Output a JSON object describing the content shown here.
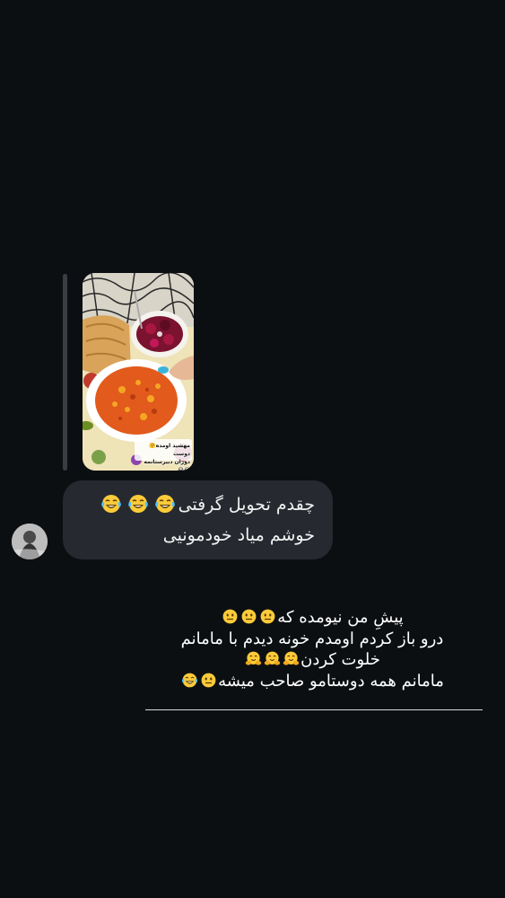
{
  "story_reply": {
    "thumbnail_caption_line1": "مهشید اومده🤗 دوست",
    "thumbnail_caption_line2": "دوران دبیرستانمه 😂😂"
  },
  "message": {
    "line1_text": "چقدم تحویل گرفتی",
    "line1_emojis": [
      "laughing-tears-emoji",
      "laughing-tears-emoji",
      "laughing-tears-emoji"
    ],
    "line2_text": "خوشم میاد خودمونیی"
  },
  "overlay_text": {
    "line1": "پیشِ من نیومده که",
    "line2": "درو باز کردم اومدم خونه دیدم با مامانم",
    "line3": "خلوت کردن",
    "line4": "مامانم همه دوستامو صاحب میشه"
  },
  "colors": {
    "background": "#0c0f12",
    "bubble": "#262a30",
    "reply_bar": "#3a3d42",
    "text": "#ffffff"
  }
}
